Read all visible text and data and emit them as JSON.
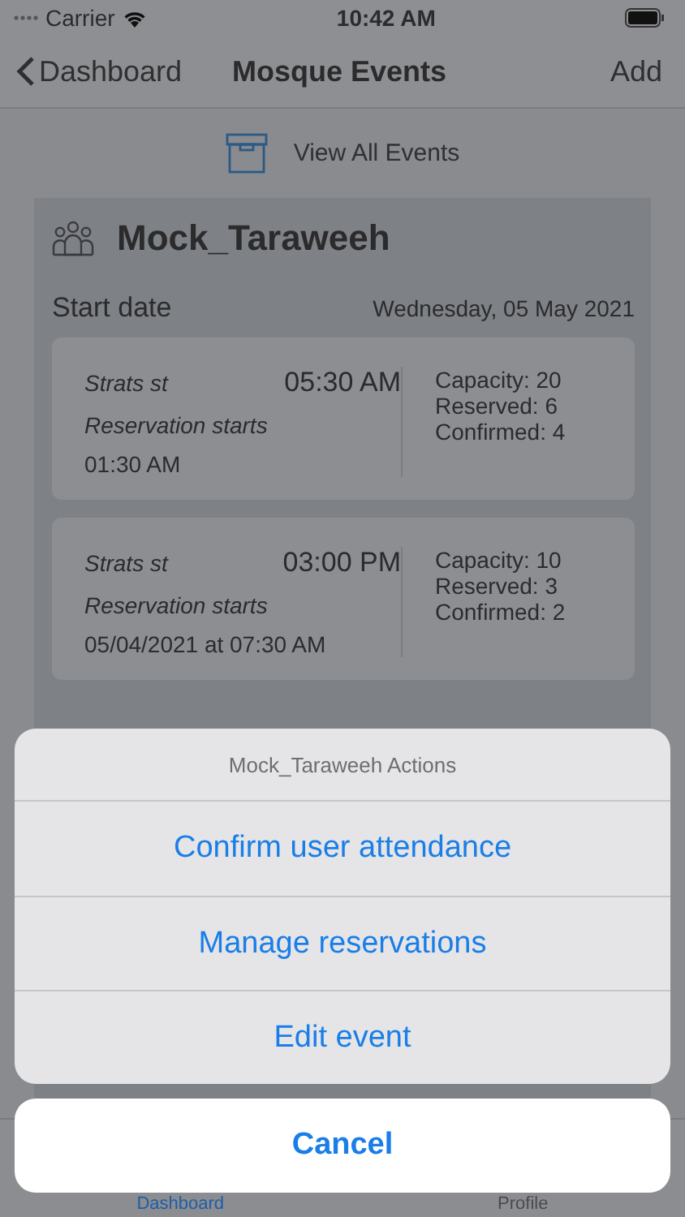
{
  "status_bar": {
    "carrier": "Carrier",
    "time": "10:42 AM"
  },
  "nav_bar": {
    "back": "Dashboard",
    "title": "Mosque Events",
    "action": "Add"
  },
  "view_all": {
    "label": "View All Events"
  },
  "event": {
    "title": "Mock_Taraweeh",
    "start_label": "Start date",
    "start_date": "Wednesday, 05 May 2021",
    "sessions": [
      {
        "label": "Strats st",
        "time": "05:30 AM",
        "reservation_label": "Reservation starts",
        "reservation_time": "01:30 AM",
        "capacity": "Capacity: 20",
        "reserved": "Reserved: 6",
        "confirmed": "Confirmed: 4"
      },
      {
        "label": "Strats st",
        "time": "03:00 PM",
        "reservation_label": "Reservation starts",
        "reservation_time": "05/04/2021 at 07:30 AM",
        "capacity": "Capacity: 10",
        "reserved": "Reserved: 3",
        "confirmed": "Confirmed: 2"
      }
    ]
  },
  "tab_bar": [
    {
      "label": "Dashboard",
      "selected": true
    },
    {
      "label": "Profile",
      "selected": false
    }
  ],
  "action_sheet": {
    "title": "Mock_Taraweeh Actions",
    "actions": [
      "Confirm user attendance",
      "Manage reservations",
      "Edit event"
    ],
    "cancel": "Cancel"
  }
}
